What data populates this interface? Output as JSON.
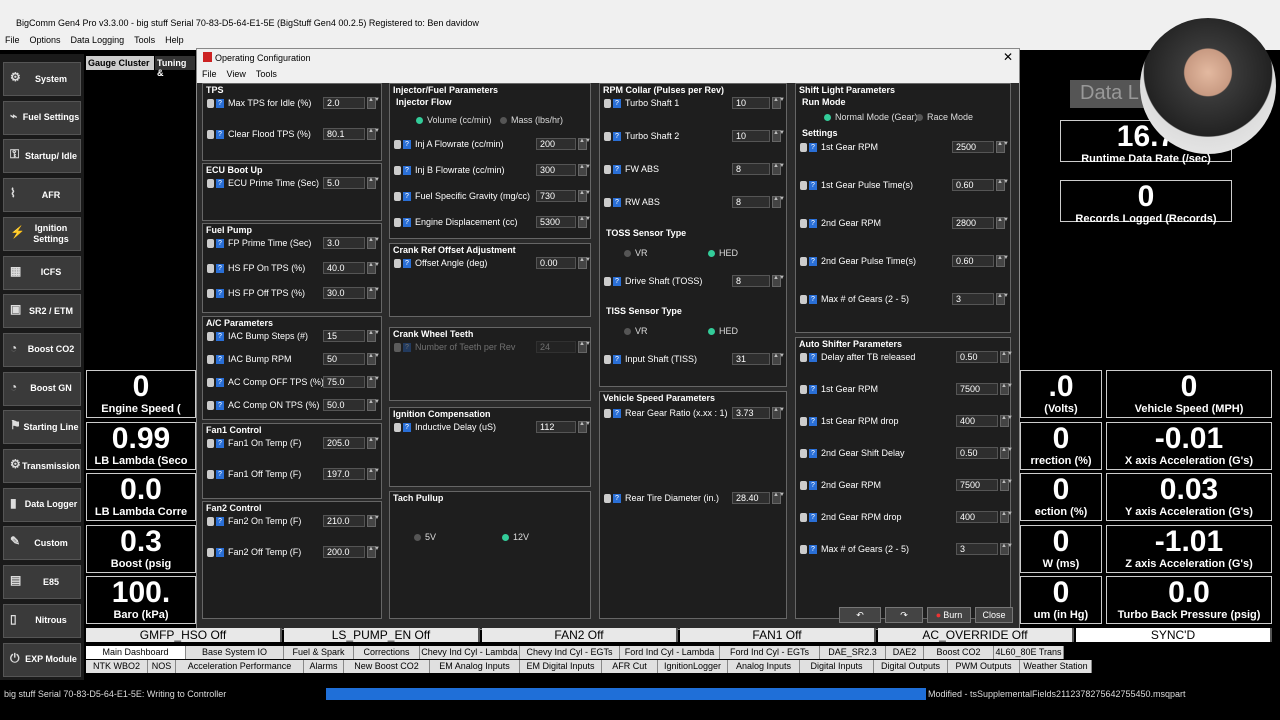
{
  "app_title": "BigComm Gen4 Pro v3.3.00 - big stuff Serial 70-83-D5-64-E1-5E (BigStuff Gen4 00.2.5) Registered to: Ben davidow",
  "menu": [
    "File",
    "Options",
    "Data Logging",
    "Tools",
    "Help"
  ],
  "top_tabs": [
    "Gauge Cluster",
    "Tuning &"
  ],
  "sidebar": [
    {
      "label": "System",
      "icon": "gear-icon"
    },
    {
      "label": "Fuel Settings",
      "icon": "fuel-injector-icon"
    },
    {
      "label": "Startup/ Idle",
      "icon": "key-icon"
    },
    {
      "label": "AFR",
      "icon": "sensor-icon"
    },
    {
      "label": "Ignition Settings",
      "icon": "spark-plug-icon"
    },
    {
      "label": "ICFS",
      "icon": "chip-icon"
    },
    {
      "label": "SR2 / ETM",
      "icon": "module-icon"
    },
    {
      "label": "Boost CO2",
      "icon": "gauge-icon"
    },
    {
      "label": "Boost GN",
      "icon": "gauge-icon"
    },
    {
      "label": "Starting Line",
      "icon": "flag-icon"
    },
    {
      "label": "Transmission",
      "icon": "gear-icon"
    },
    {
      "label": "Data Logger",
      "icon": "chart-icon"
    },
    {
      "label": "Custom",
      "icon": "wrench-icon"
    },
    {
      "label": "E85",
      "icon": "fuel-icon"
    },
    {
      "label": "Nitrous",
      "icon": "bottle-icon"
    },
    {
      "label": "EXP Module",
      "icon": "plug-icon"
    }
  ],
  "gauges_left": [
    {
      "value": "0",
      "name": "Engine Speed ("
    },
    {
      "value": "0.99",
      "name": "LB Lambda (Seco"
    },
    {
      "value": "0.0",
      "name": "LB Lambda Corre"
    },
    {
      "value": "0.3",
      "name": "Boost (psig"
    },
    {
      "value": "100.",
      "name": "Baro (kPa)"
    }
  ],
  "gauges_mid": [
    {
      "value": ".0",
      "name": "(Volts)"
    },
    {
      "value": "0",
      "name": "rrection (%)"
    },
    {
      "value": "0",
      "name": "ection (%)"
    },
    {
      "value": "0",
      "name": "W (ms)"
    },
    {
      "value": "0",
      "name": "um (in Hg)"
    }
  ],
  "gauges_right": [
    {
      "value": "0",
      "name": "Vehicle Speed (MPH)"
    },
    {
      "value": "-0.01",
      "name": "X axis Acceleration (G's)"
    },
    {
      "value": "0.03",
      "name": "Y axis Acceleration (G's)"
    },
    {
      "value": "-1.01",
      "name": "Z axis Acceleration (G's)"
    },
    {
      "value": "0.0",
      "name": "Turbo Back Pressure (psig)"
    }
  ],
  "gauges_top_right": [
    {
      "value": "16.7",
      "name": "Runtime Data Rate (/sec)"
    },
    {
      "value": "0",
      "name": "Records Logged (Records)"
    }
  ],
  "data_label": "Data L",
  "dialog": {
    "title": "Operating Configuration",
    "menu": [
      "File",
      "View",
      "Tools"
    ],
    "tps": {
      "header": "TPS",
      "rows": [
        {
          "label": "Max TPS for Idle (%)",
          "value": "2.0"
        },
        {
          "label": "Clear Flood TPS (%)",
          "value": "80.1"
        }
      ]
    },
    "ecu_boot": {
      "header": "ECU Boot Up",
      "rows": [
        {
          "label": "ECU Prime Time (Sec)",
          "value": "5.0"
        }
      ]
    },
    "fuel_pump": {
      "header": "Fuel Pump",
      "rows": [
        {
          "label": "FP Prime Time (Sec)",
          "value": "3.0"
        },
        {
          "label": "HS FP On TPS (%)",
          "value": "40.0"
        },
        {
          "label": "HS FP Off TPS (%)",
          "value": "30.0"
        }
      ]
    },
    "ac": {
      "header": "A/C Parameters",
      "rows": [
        {
          "label": "IAC Bump Steps (#)",
          "value": "15"
        },
        {
          "label": "IAC Bump RPM",
          "value": "50"
        },
        {
          "label": "AC Comp OFF TPS (%)",
          "value": "75.0"
        },
        {
          "label": "AC Comp ON TPS (%)",
          "value": "50.0"
        }
      ]
    },
    "fan1": {
      "header": "Fan1 Control",
      "rows": [
        {
          "label": "Fan1 On Temp (F)",
          "value": "205.0"
        },
        {
          "label": "Fan1 Off Temp (F)",
          "value": "197.0"
        }
      ]
    },
    "fan2": {
      "header": "Fan2 Control",
      "rows": [
        {
          "label": "Fan2 On Temp (F)",
          "value": "210.0"
        },
        {
          "label": "Fan2 Off Temp (F)",
          "value": "200.0"
        }
      ]
    },
    "injector": {
      "header": "Injector/Fuel Parameters",
      "sub": "Injector Flow",
      "radio": [
        "Volume (cc/min)",
        "Mass (lbs/hr)"
      ],
      "rows": [
        {
          "label": "Inj A Flowrate (cc/min)",
          "value": "200"
        },
        {
          "label": "Inj B Flowrate (cc/min)",
          "value": "300"
        },
        {
          "label": "Fuel Specific Gravity (mg/cc)",
          "value": "730"
        },
        {
          "label": "Engine Displacement (cc)",
          "value": "5300"
        }
      ]
    },
    "crank_ref": {
      "header": "Crank Ref Offset Adjustment",
      "rows": [
        {
          "label": "Offset Angle  (deg)",
          "value": "0.00"
        }
      ]
    },
    "crank_wheel": {
      "header": "Crank Wheel Teeth",
      "rows": [
        {
          "label": "Number of Teeth per Rev",
          "value": "24"
        }
      ]
    },
    "ign_comp": {
      "header": "Ignition Compensation",
      "rows": [
        {
          "label": "Inductive Delay (uS)",
          "value": "112"
        }
      ]
    },
    "tach": {
      "header": "Tach Pullup",
      "radio": [
        "5V",
        "12V"
      ]
    },
    "rpm_collar": {
      "header": "RPM Collar (Pulses per Rev)",
      "rows": [
        {
          "label": "Turbo Shaft 1",
          "value": "10"
        },
        {
          "label": "Turbo Shaft 2",
          "value": "10"
        },
        {
          "label": "FW ABS",
          "value": "8"
        },
        {
          "label": "RW ABS",
          "value": "8"
        }
      ]
    },
    "toss": {
      "header": "TOSS Sensor Type",
      "radio": [
        "VR",
        "HED"
      ],
      "rows": [
        {
          "label": "Drive Shaft (TOSS)",
          "value": "8"
        }
      ]
    },
    "tiss": {
      "header": "TISS Sensor Type",
      "radio": [
        "VR",
        "HED"
      ],
      "rows": [
        {
          "label": "Input Shaft (TISS)",
          "value": "31"
        }
      ]
    },
    "vehicle_speed": {
      "header": "Vehicle Speed Parameters",
      "rows": [
        {
          "label": "Rear Gear Ratio (x.xx : 1)",
          "value": "3.73"
        },
        {
          "label": "Rear Tire Diameter (in.)",
          "value": "28.40"
        }
      ]
    },
    "shift_light": {
      "header": "Shift Light Parameters",
      "run_mode": "Run Mode",
      "radio": [
        "Normal Mode (Gear)",
        "Race Mode"
      ],
      "settings": "Settings",
      "rows": [
        {
          "label": "1st Gear RPM",
          "value": "2500"
        },
        {
          "label": "1st Gear Pulse Time(s)",
          "value": "0.60"
        },
        {
          "label": "2nd Gear RPM",
          "value": "2800"
        },
        {
          "label": "2nd Gear Pulse Time(s)",
          "value": "0.60"
        },
        {
          "label": "Max # of Gears (2 - 5)",
          "value": "3"
        }
      ]
    },
    "auto_shifter": {
      "header": "Auto Shifter Parameters",
      "rows": [
        {
          "label": "Delay after TB released",
          "value": "0.50"
        },
        {
          "label": "1st Gear RPM",
          "value": "7500"
        },
        {
          "label": "1st Gear RPM drop",
          "value": "400"
        },
        {
          "label": "2nd Gear Shift Delay",
          "value": "0.50"
        },
        {
          "label": "2nd Gear RPM",
          "value": "7500"
        },
        {
          "label": "2nd Gear RPM drop",
          "value": "400"
        },
        {
          "label": "Max # of Gears (2 - 5)",
          "value": "3"
        }
      ]
    },
    "buttons": {
      "burn": "Burn",
      "close": "Close"
    }
  },
  "indicators": [
    "GMFP_HSO Off",
    "LS_PUMP_EN Off",
    "FAN2 Off",
    "FAN1 Off",
    "AC_OVERRIDE Off",
    "SYNC'D"
  ],
  "tabs_row1": [
    "Main Dashboard",
    "Base System IO",
    "Fuel & Spark",
    "Corrections",
    "Chevy Ind Cyl - Lambda",
    "Chevy Ind Cyl - EGTs",
    "Ford Ind Cyl - Lambda",
    "Ford Ind Cyl - EGTs",
    "DAE_SR2.3",
    "DAE2",
    "Boost CO2",
    "4L60_80E Trans"
  ],
  "tabs_row2": [
    "NTK WBO2",
    "NOS",
    "Acceleration Performance",
    "Alarms",
    "New Boost CO2",
    "EM Analog Inputs",
    "EM Digital Inputs",
    "AFR Cut",
    "IgnitionLogger",
    "Analog Inputs",
    "Digital Inputs",
    "Digital Outputs",
    "PWM Outputs",
    "Weather Station"
  ],
  "status": {
    "left": "big stuff Serial 70-83-D5-64-E1-5E: Writing to Controller",
    "right": "Modified - tsSupplementalFields2112378275642755450.msqpart"
  }
}
